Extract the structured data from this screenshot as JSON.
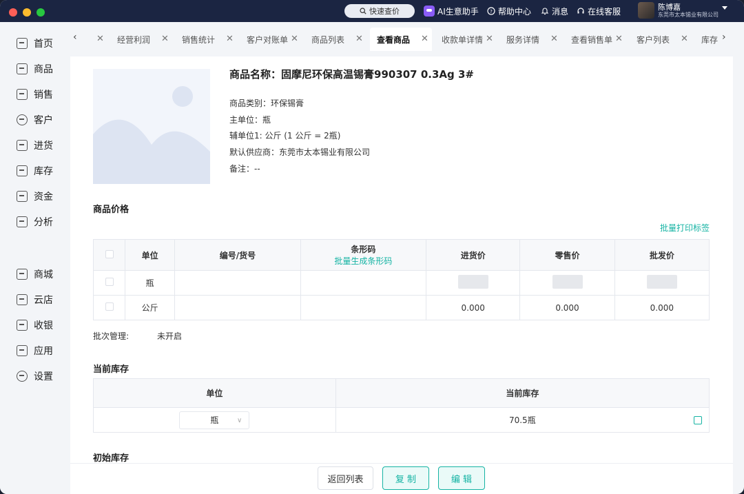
{
  "titlebar": {
    "quick_search": "快速查价",
    "ai_assistant": "AI生意助手",
    "help_center": "帮助中心",
    "messages": "消息",
    "online_service": "在线客服",
    "user_name": "陈博嘉",
    "user_company": "东莞市太本锡业有限公司"
  },
  "sidebar": {
    "items": [
      {
        "label": "首页",
        "icon": "home-icon"
      },
      {
        "label": "商品",
        "icon": "box-icon"
      },
      {
        "label": "销售",
        "icon": "clipboard-icon"
      },
      {
        "label": "客户",
        "icon": "user-icon"
      },
      {
        "label": "进货",
        "icon": "purchase-icon"
      },
      {
        "label": "库存",
        "icon": "warehouse-icon"
      },
      {
        "label": "资金",
        "icon": "wallet-icon"
      },
      {
        "label": "分析",
        "icon": "chart-icon"
      },
      {
        "label": "商城",
        "icon": "shop-icon"
      },
      {
        "label": "云店",
        "icon": "cloud-shop-icon"
      },
      {
        "label": "收银",
        "icon": "cashier-icon"
      },
      {
        "label": "应用",
        "icon": "apps-icon"
      },
      {
        "label": "设置",
        "icon": "gear-icon"
      }
    ]
  },
  "tabs": {
    "items": [
      "经营利润",
      "销售统计",
      "客户对账单",
      "商品列表",
      "查看商品",
      "收款单详情",
      "服务详情",
      "查看销售单",
      "客户列表",
      "库存"
    ],
    "active_index": 4
  },
  "product": {
    "title": "商品名称：固摩尼环保高温锡膏990307 0.3Ag 3#",
    "category": "商品类别：环保锡膏",
    "main_unit": "主单位：瓶",
    "sub_unit": "辅单位1:   公斤 (1 公斤 = 2瓶)",
    "supplier": "默认供应商：东莞市太本锡业有限公司",
    "remark": "备注：--"
  },
  "price_section": {
    "title": "商品价格",
    "batch_print": "批量打印标签",
    "headers": {
      "unit": "单位",
      "code": "编号/货号",
      "barcode": "条形码",
      "barcode_link": "批量生成条形码",
      "purchase": "进货价",
      "retail": "零售价",
      "wholesale": "批发价"
    },
    "rows": [
      {
        "unit": "瓶",
        "code": "",
        "barcode": "",
        "purchase": "",
        "retail": "",
        "wholesale": ""
      },
      {
        "unit": "公斤",
        "code": "",
        "barcode": "",
        "purchase": "0.000",
        "retail": "0.000",
        "wholesale": "0.000"
      }
    ],
    "batch_label": "批次管理:",
    "batch_value": "未开启"
  },
  "stock_section": {
    "title": "当前库存",
    "headers": {
      "unit": "单位",
      "stock": "当前库存"
    },
    "selected_unit": "瓶",
    "stock_value": "70.5瓶"
  },
  "initial_stock": {
    "title": "初始库存"
  },
  "footer": {
    "back": "返回列表",
    "copy": "复 制",
    "edit": "编 辑"
  },
  "colors": {
    "accent": "#14b3a3",
    "titlebar": "#1b2542"
  }
}
